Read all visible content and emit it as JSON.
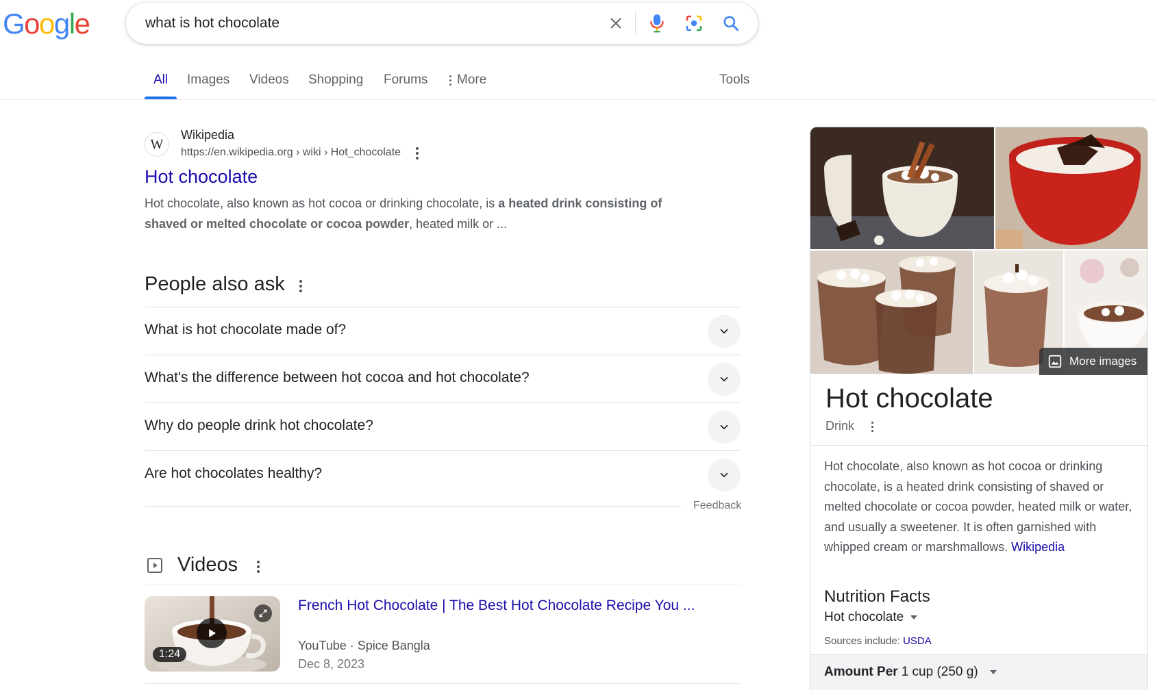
{
  "logo": {
    "text": "Google"
  },
  "search": {
    "query": "what is hot chocolate"
  },
  "tabs": [
    {
      "label": "All"
    },
    {
      "label": "Images"
    },
    {
      "label": "Videos"
    },
    {
      "label": "Shopping"
    },
    {
      "label": "Forums"
    },
    {
      "label": "More"
    }
  ],
  "tools_label": "Tools",
  "result": {
    "favicon_letter": "W",
    "site": "Wikipedia",
    "url": "https://en.wikipedia.org › wiki › Hot_chocolate",
    "title": "Hot chocolate",
    "snippet_pre": "Hot chocolate, also known as hot cocoa or drinking chocolate, is ",
    "snippet_bold": "a heated drink consisting of shaved or melted chocolate or cocoa powder",
    "snippet_post": ", heated milk or ..."
  },
  "paa": {
    "title": "People also ask",
    "questions": [
      "What is hot chocolate made of?",
      "What's the difference between hot cocoa and hot chocolate?",
      "Why do people drink hot chocolate?",
      "Are hot chocolates healthy?"
    ],
    "feedback": "Feedback"
  },
  "videos": {
    "title": "Videos",
    "items": [
      {
        "title": "French Hot Chocolate | The Best Hot Chocolate Recipe You ...",
        "source": "YouTube · Spice Bangla",
        "date": "Dec 8, 2023",
        "duration": "1:24"
      }
    ]
  },
  "knowledge_panel": {
    "more_images": "More images",
    "title": "Hot chocolate",
    "subtitle": "Drink",
    "description": "Hot chocolate, also known as hot cocoa or drinking chocolate, is a heated drink consisting of shaved or melted chocolate or cocoa powder, heated milk or water, and usually a sweetener. It is often garnished with whipped cream or marshmallows.",
    "description_link": "Wikipedia",
    "nutrition": {
      "title": "Nutrition Facts",
      "item": "Hot chocolate",
      "sources_prefix": "Sources include:",
      "sources_link": "USDA",
      "amount_label": "Amount Per",
      "amount_value": "1 cup (250 g)"
    }
  },
  "colors": {
    "link": "#1a0dab",
    "accent": "#1a73e8",
    "text": "#202124",
    "muted": "#4d5156"
  }
}
